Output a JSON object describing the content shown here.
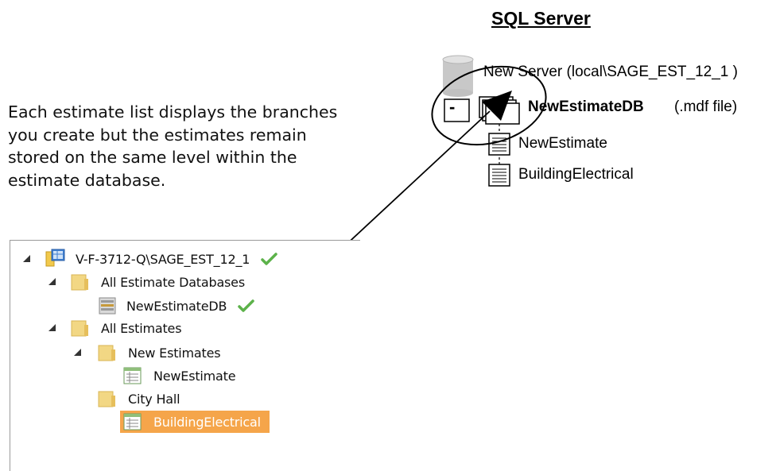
{
  "sql_server": {
    "title": "SQL Server",
    "server_label": "New Server (local\\SAGE_EST_12_1 )",
    "database_label": "NewEstimateDB",
    "database_type": "(.mdf file)",
    "collapse_symbol": "-",
    "estimates": [
      "NewEstimate",
      "BuildingElectrical"
    ]
  },
  "explanation": {
    "lines": [
      "Each estimate list displays the branches",
      "you create but the estimates remain",
      "stored on the same level within the",
      "estimate database."
    ]
  },
  "tree": {
    "server": "V-F-3712-Q\\SAGE_EST_12_1",
    "databases_folder": "All Estimate Databases",
    "database": "NewEstimateDB",
    "estimates_folder": "All Estimates",
    "subfolder_1": "New Estimates",
    "estimate_1": "NewEstimate",
    "subfolder_2": "City Hall",
    "estimate_2": "BuildingElectrical",
    "selected_item": "BuildingElectrical"
  },
  "colors": {
    "selection": "#f5a54a",
    "check": "#5cb24a",
    "folder": "#f2d784"
  }
}
